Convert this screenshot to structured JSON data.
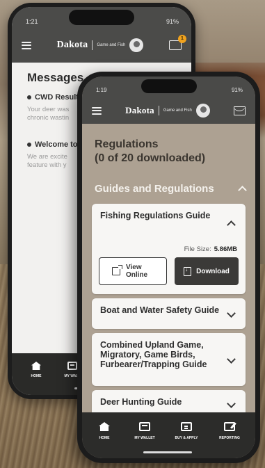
{
  "back_phone": {
    "status": {
      "time": "1:21",
      "battery": "91%"
    },
    "header": {
      "logo_small": "NORTH",
      "logo": "Dakota",
      "subtitle": "Game and Fish"
    },
    "notification_count": "1",
    "title": "Messages",
    "messages": [
      {
        "title": "CWD Result",
        "body_line1": "Your deer was",
        "body_line2": "chronic wastin"
      },
      {
        "title": "Welcome to",
        "body_line1": "We are excite",
        "body_line2": "feature with y"
      }
    ],
    "tabs": [
      {
        "label": "HOME"
      },
      {
        "label": "MY WALL"
      }
    ]
  },
  "front_phone": {
    "status": {
      "time": "1:19",
      "battery": "91%"
    },
    "header": {
      "logo": "Dakota",
      "subtitle": "Game and Fish"
    },
    "title_line1": "Regulations",
    "title_line2": "(0 of 20 downloaded)",
    "section": {
      "label": "Guides and Regulations"
    },
    "cards": [
      {
        "title": "Fishing Regulations Guide",
        "file_size_label": "File Size:",
        "file_size_value": "5.86MB",
        "view_label": "View Online",
        "download_label": "Download"
      },
      {
        "title": "Boat and Water Safety Guide"
      },
      {
        "title": "Combined Upland Game, Migratory, Game Birds, Furbearer/Trapping Guide"
      },
      {
        "title": "Deer Hunting Guide"
      }
    ],
    "tabs": [
      {
        "label": "HOME",
        "icon": "home-icon"
      },
      {
        "label": "MY WALLET",
        "icon": "wallet-icon"
      },
      {
        "label": "BUY & APPLY",
        "icon": "license-card-icon"
      },
      {
        "label": "REPORTING",
        "icon": "edit-icon"
      }
    ]
  },
  "colors": {
    "header_bg": "#4a4a48",
    "tabbar_bg": "#2c2c2a",
    "content_bg": "#ada192",
    "card_bg": "#f7f6f4",
    "download_bg": "#3b3a38",
    "badge": "#f0a21e"
  }
}
